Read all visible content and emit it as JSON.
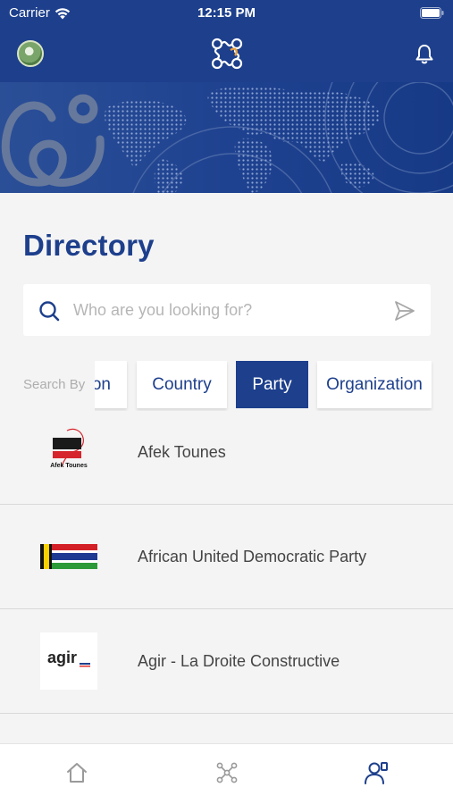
{
  "status_bar": {
    "carrier": "Carrier",
    "time": "12:15 PM"
  },
  "header": {
    "app": "app-logo"
  },
  "page": {
    "title": "Directory"
  },
  "search": {
    "placeholder": "Who are you looking for?"
  },
  "filters": {
    "label": "Search By",
    "options": [
      "on",
      "Country",
      "Party",
      "Organization"
    ],
    "selected": "Party"
  },
  "results": [
    {
      "name": "Afek Tounes",
      "logo_text": "Afek Tounes"
    },
    {
      "name": "African United Democratic Party"
    },
    {
      "name": "Agir - La Droite Constructive",
      "logo_text": "agir"
    }
  ],
  "colors": {
    "primary": "#1d3f8c",
    "background": "#f4f4f4",
    "placeholder": "#b6b6b6"
  },
  "tabs": [
    "home-icon",
    "network-icon",
    "directory-icon"
  ]
}
